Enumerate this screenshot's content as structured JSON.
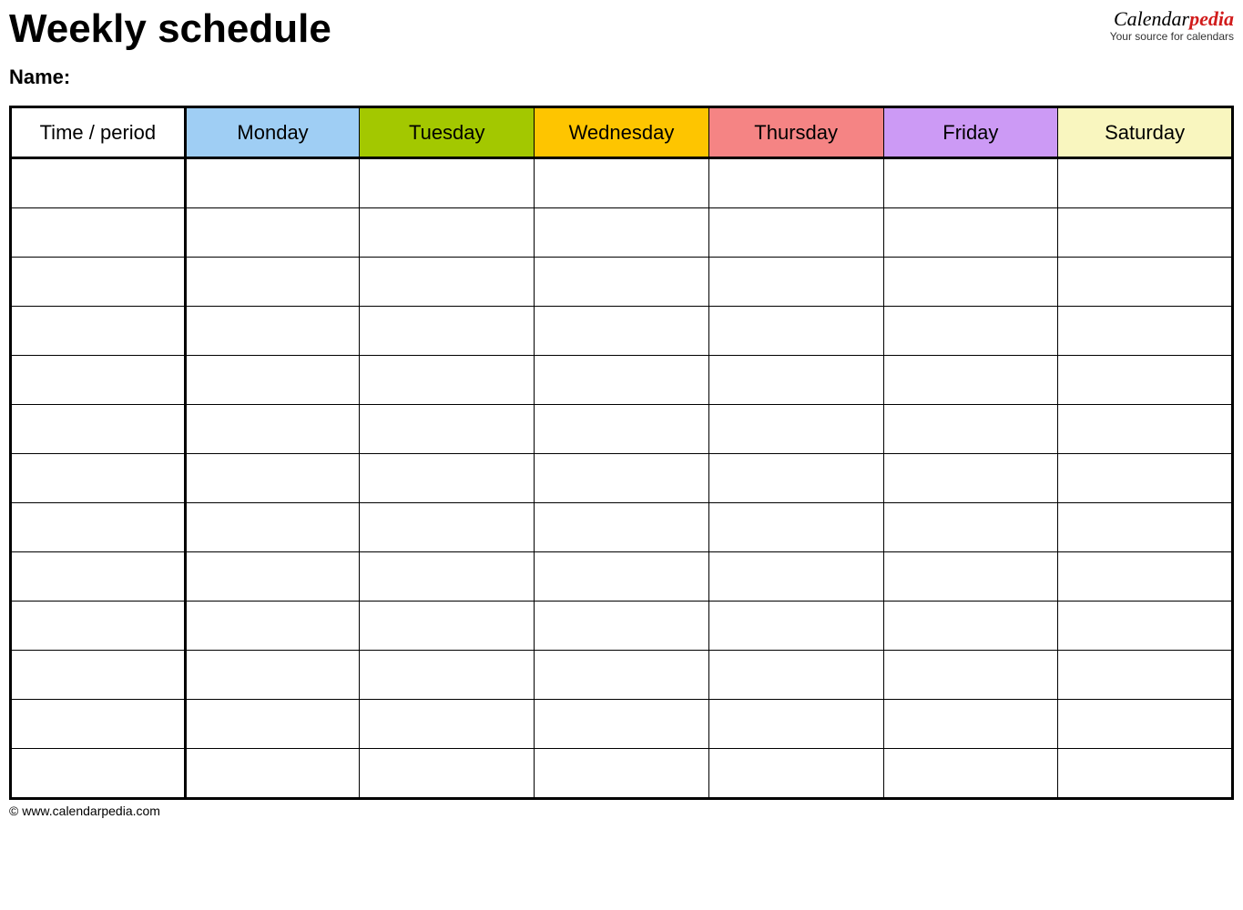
{
  "title": "Weekly schedule",
  "name_label": "Name:",
  "brand": {
    "part1": "Calendar",
    "part2": "pedia",
    "tagline": "Your source for calendars"
  },
  "table": {
    "time_header": "Time / period",
    "days": [
      {
        "label": "Monday",
        "color": "#9fcef4"
      },
      {
        "label": "Tuesday",
        "color": "#a3c800"
      },
      {
        "label": "Wednesday",
        "color": "#fec500"
      },
      {
        "label": "Thursday",
        "color": "#f58484"
      },
      {
        "label": "Friday",
        "color": "#cc9af5"
      },
      {
        "label": "Saturday",
        "color": "#f9f6bf"
      }
    ],
    "row_count": 13
  },
  "footer": "© www.calendarpedia.com"
}
